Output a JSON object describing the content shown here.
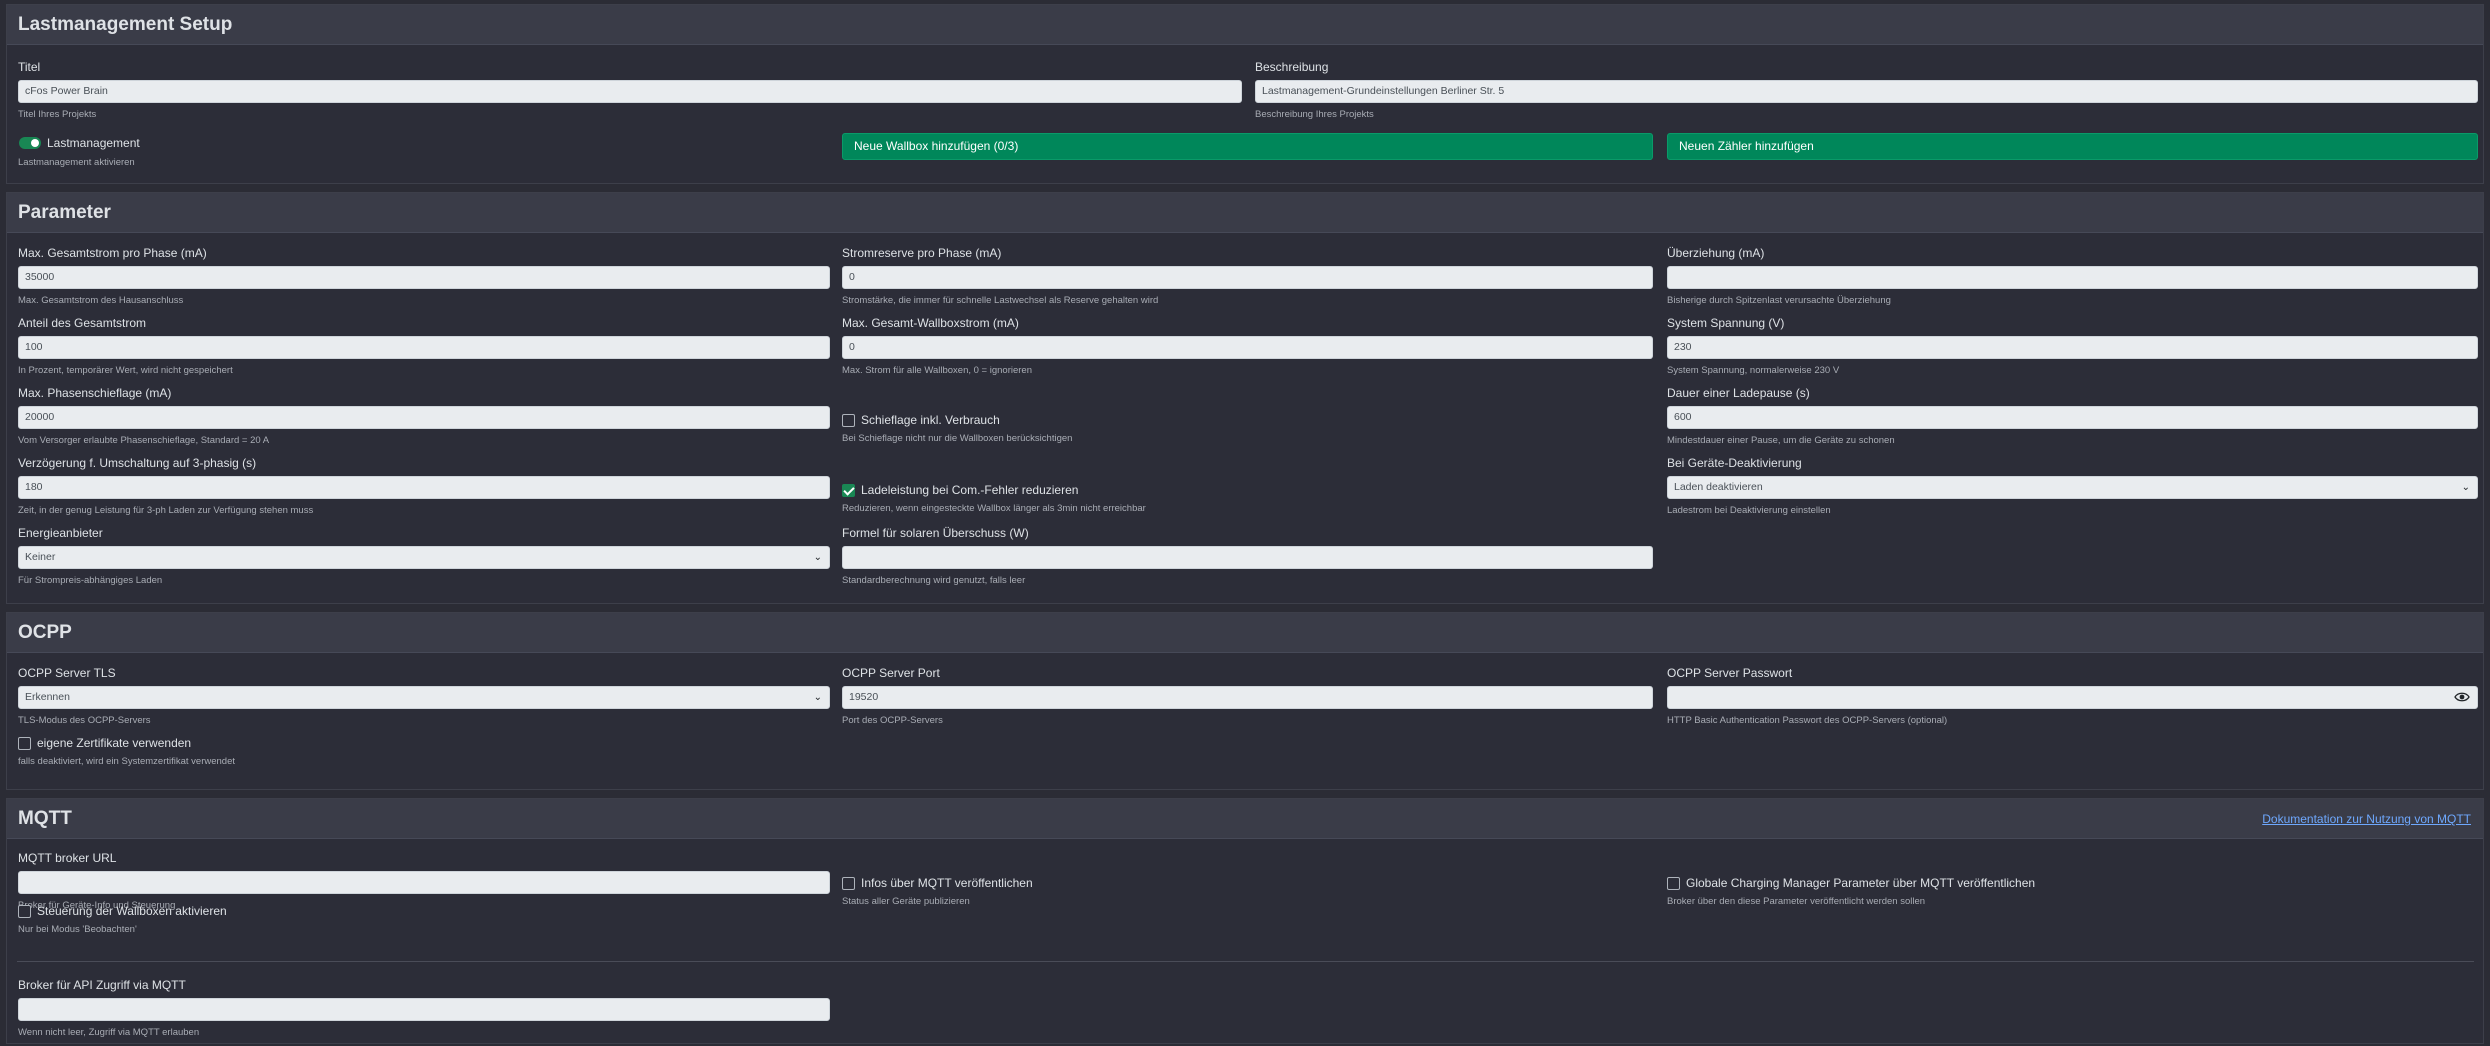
{
  "setup": {
    "header": "Lastmanagement Setup",
    "title_label": "Titel",
    "title_value": "cFos Power Brain",
    "title_help": "Titel Ihres Projekts",
    "desc_label": "Beschreibung",
    "desc_value": "Lastmanagement-Grundeinstellungen Berliner Str. 5",
    "desc_help": "Beschreibung Ihres Projekts",
    "lm_label": "Lastmanagement",
    "lm_help": "Lastmanagement aktivieren",
    "add_wallbox": "Neue Wallbox hinzufügen (0/3)",
    "add_meter": "Neuen Zähler hinzufügen"
  },
  "params": {
    "header": "Parameter",
    "max_total_label": "Max. Gesamtstrom pro Phase (mA)",
    "max_total_value": "35000",
    "max_total_help": "Max. Gesamtstrom des Hausanschluss",
    "reserve_label": "Stromreserve pro Phase (mA)",
    "reserve_value": "0",
    "reserve_help": "Stromstärke, die immer für schnelle Lastwechsel als Reserve gehalten wird",
    "overdraw_label": "Überziehung (mA)",
    "overdraw_value": "",
    "overdraw_help": "Bisherige durch Spitzenlast verursachte Überziehung",
    "share_label": "Anteil des Gesamtstrom",
    "share_value": "100",
    "share_help": "In Prozent, temporärer Wert, wird nicht gespeichert",
    "max_wb_label": "Max. Gesamt-Wallboxstrom (mA)",
    "max_wb_value": "0",
    "max_wb_help": "Max. Strom für alle Wallboxen, 0 = ignorieren",
    "voltage_label": "System Spannung (V)",
    "voltage_value": "230",
    "voltage_help": "System Spannung, normalerweise 230 V",
    "phase_label": "Max. Phasenschieflage (mA)",
    "phase_value": "20000",
    "phase_help": "Vom Versorger erlaubte Phasenschieflage, Standard = 20 A",
    "skew_label": "Schieflage inkl. Verbrauch",
    "skew_help": "Bei Schieflage nicht nur die Wallboxen berücksichtigen",
    "pause_label": "Dauer einer Ladepause (s)",
    "pause_value": "600",
    "pause_help": "Mindestdauer einer Pause, um die Geräte zu schonen",
    "delay_label": "Verzögerung f. Umschaltung auf 3-phasig (s)",
    "delay_value": "180",
    "delay_help": "Zeit, in der genug Leistung für 3-ph Laden zur Verfügung stehen muss",
    "reduce_label": "Ladeleistung bei Com.-Fehler reduzieren",
    "reduce_help": "Reduzieren, wenn eingesteckte Wallbox länger als 3min nicht erreichbar",
    "deact_label": "Bei Geräte-Deaktivierung",
    "deact_value": "Laden deaktivieren",
    "deact_help": "Ladestrom bei Deaktivierung einstellen",
    "energy_label": "Energieanbieter",
    "energy_value": "Keiner",
    "energy_help": "Für Strompreis-abhängiges Laden",
    "formula_label": "Formel für solaren Überschuss (W)",
    "formula_value": "",
    "formula_help": "Standardberechnung wird genutzt, falls leer"
  },
  "ocpp": {
    "header": "OCPP",
    "tls_label": "OCPP Server TLS",
    "tls_value": "Erkennen",
    "tls_help": "TLS-Modus des OCPP-Servers",
    "port_label": "OCPP Server Port",
    "port_value": "19520",
    "port_help": "Port des OCPP-Servers",
    "pw_label": "OCPP Server Passwort",
    "pw_value": "",
    "pw_help": "HTTP Basic Authentication Passwort des OCPP-Servers (optional)",
    "cert_label": "eigene Zertifikate verwenden",
    "cert_help": "falls deaktiviert, wird ein Systemzertifikat verwendet"
  },
  "mqtt": {
    "header": "MQTT",
    "doc_link": "Dokumentation zur Nutzung von MQTT",
    "broker_label": "MQTT broker URL",
    "broker_value": "",
    "broker_help": "Broker für Geräte-Info und Steuerung",
    "publish_label": "Infos über MQTT veröffentlichen",
    "publish_help": "Status aller Geräte publizieren",
    "global_label": "Globale Charging Manager Parameter über MQTT veröffentlichen",
    "global_help": "Broker über den diese Parameter veröffentlicht werden sollen",
    "control_label": "Steuerung der Wallboxen aktivieren",
    "control_help": "Nur bei Modus 'Beobachten'",
    "api_label": "Broker für API Zugriff via MQTT",
    "api_value": "",
    "api_help": "Wenn nicht leer, Zugriff via MQTT erlauben"
  },
  "icons": {
    "select_chevron": "chevron-down-icon",
    "password_toggle": "eye-icon"
  },
  "colors": {
    "accent_green": "#00875a",
    "link_blue": "#6ea8fe",
    "background": "#2b2c35"
  }
}
